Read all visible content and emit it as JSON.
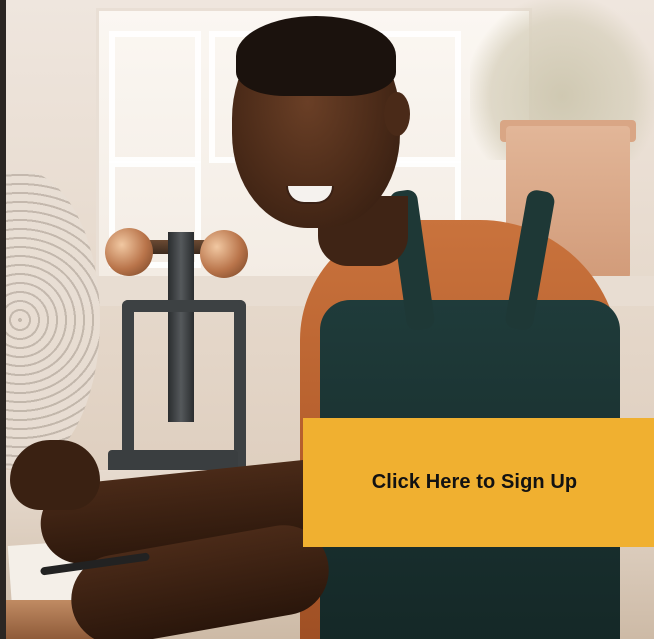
{
  "cta": {
    "label": "Click Here to Sign Up",
    "background_color": "#f0b030",
    "text_color": "#121212"
  },
  "hero_image": {
    "icon": "photo-man-at-workbench"
  }
}
